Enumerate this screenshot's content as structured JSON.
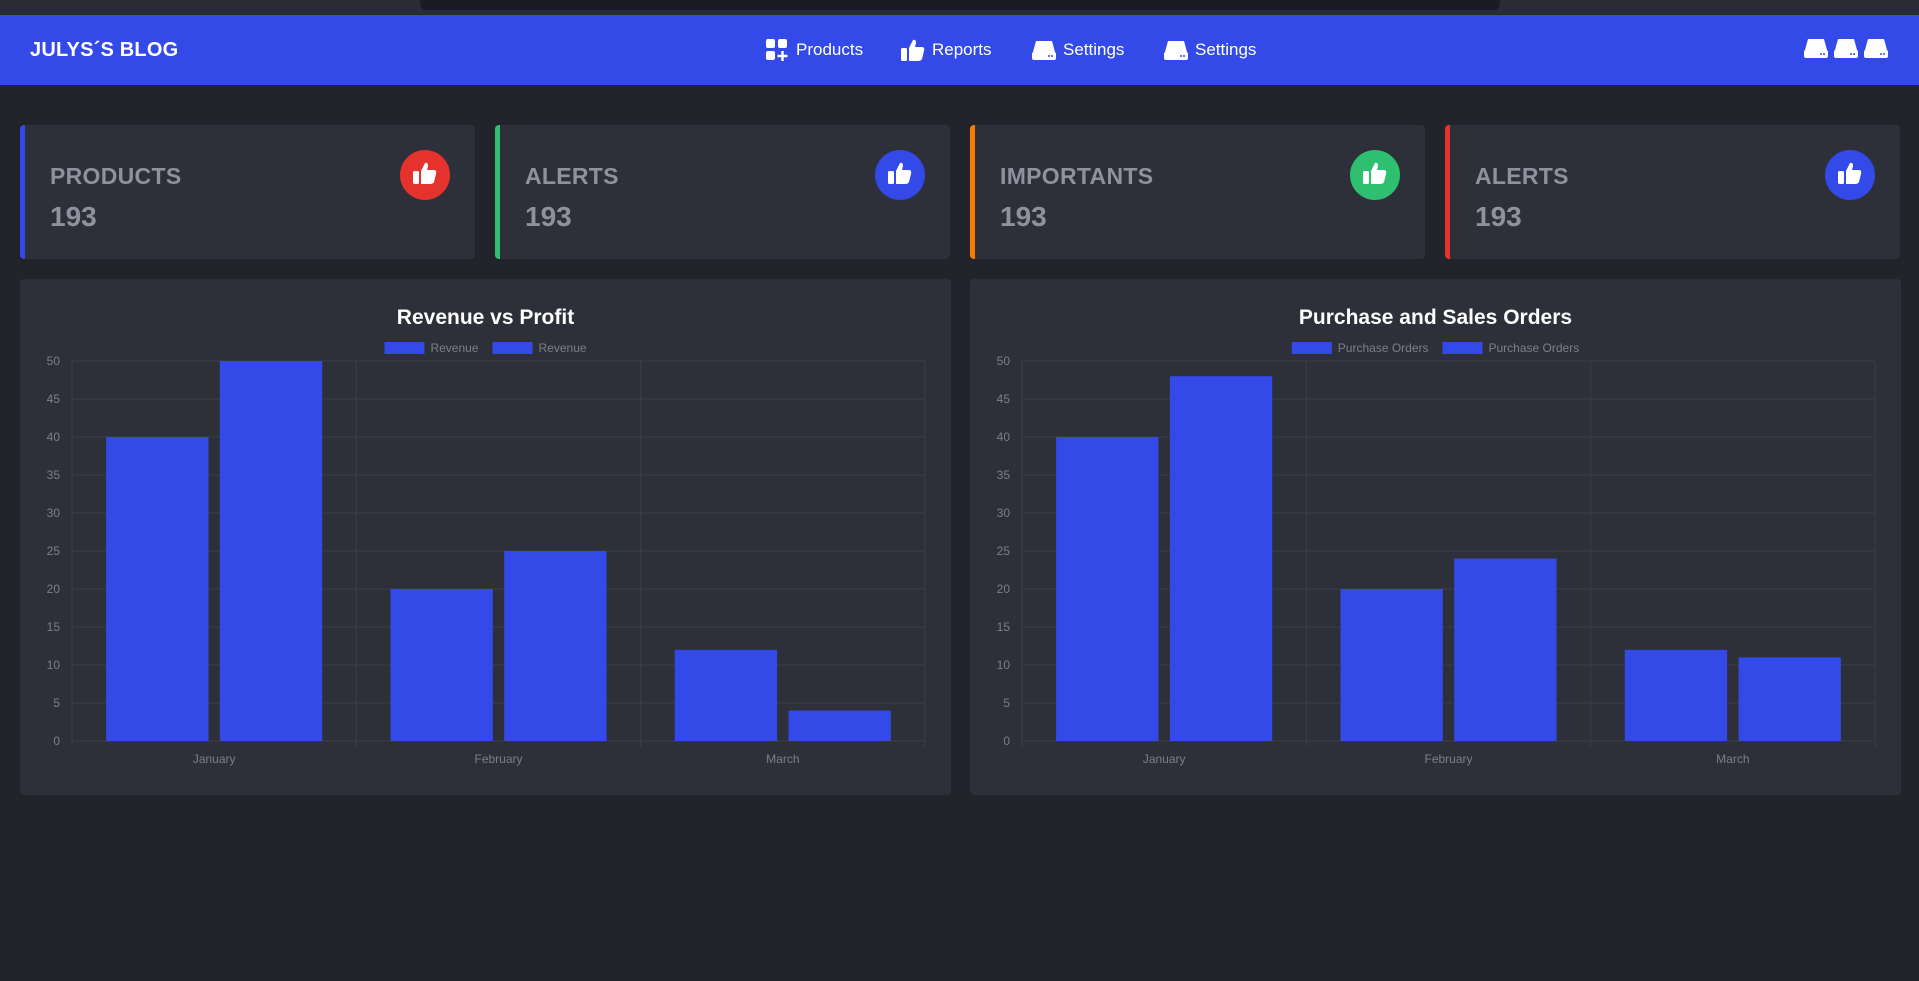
{
  "brand": "JULYS´S BLOG",
  "nav": [
    {
      "label": "Products",
      "icon": "grid-plus-icon"
    },
    {
      "label": "Reports",
      "icon": "thumbs-up-icon"
    },
    {
      "label": "Settings",
      "icon": "hard-drive-icon"
    },
    {
      "label": "Settings",
      "icon": "hard-drive-icon"
    }
  ],
  "nav_right_icons": [
    "hard-drive-icon",
    "hard-drive-icon",
    "hard-drive-icon"
  ],
  "cards": [
    {
      "label": "PRODUCTS",
      "value": "193",
      "accent": "#344ae8",
      "icon_bg": "#e5322d",
      "icon": "thumbs-up-icon"
    },
    {
      "label": "ALERTS",
      "value": "193",
      "accent": "#2fbf71",
      "icon_bg": "#344ae8",
      "icon": "thumbs-up-icon"
    },
    {
      "label": "IMPORTANTS",
      "value": "193",
      "accent": "#f57c00",
      "icon_bg": "#2fbf71",
      "icon": "thumbs-up-icon"
    },
    {
      "label": "ALERTS",
      "value": "193",
      "accent": "#e5322d",
      "icon_bg": "#344ae8",
      "icon": "thumbs-up-icon"
    }
  ],
  "colors": {
    "bar": "#344ae8",
    "grid": "#3a3d47",
    "axis_text": "#7c7f8a"
  },
  "chart_data": [
    {
      "type": "bar",
      "title": "Revenue vs Profit",
      "categories": [
        "January",
        "February",
        "March"
      ],
      "series": [
        {
          "name": "Revenue",
          "values": [
            40,
            20,
            12
          ]
        },
        {
          "name": "Revenue",
          "values": [
            50,
            25,
            4
          ]
        }
      ],
      "ylim": [
        0,
        50
      ],
      "yticks": [
        0,
        5,
        10,
        15,
        20,
        25,
        30,
        35,
        40,
        45,
        50
      ],
      "grid": true,
      "legend": "top-center"
    },
    {
      "type": "bar",
      "title": "Purchase and Sales Orders",
      "categories": [
        "January",
        "February",
        "March"
      ],
      "series": [
        {
          "name": "Purchase Orders",
          "values": [
            40,
            20,
            12
          ]
        },
        {
          "name": "Purchase Orders",
          "values": [
            48,
            24,
            11
          ]
        }
      ],
      "ylim": [
        0,
        50
      ],
      "yticks": [
        0,
        5,
        10,
        15,
        20,
        25,
        30,
        35,
        40,
        45,
        50
      ],
      "grid": true,
      "legend": "top-center"
    }
  ]
}
